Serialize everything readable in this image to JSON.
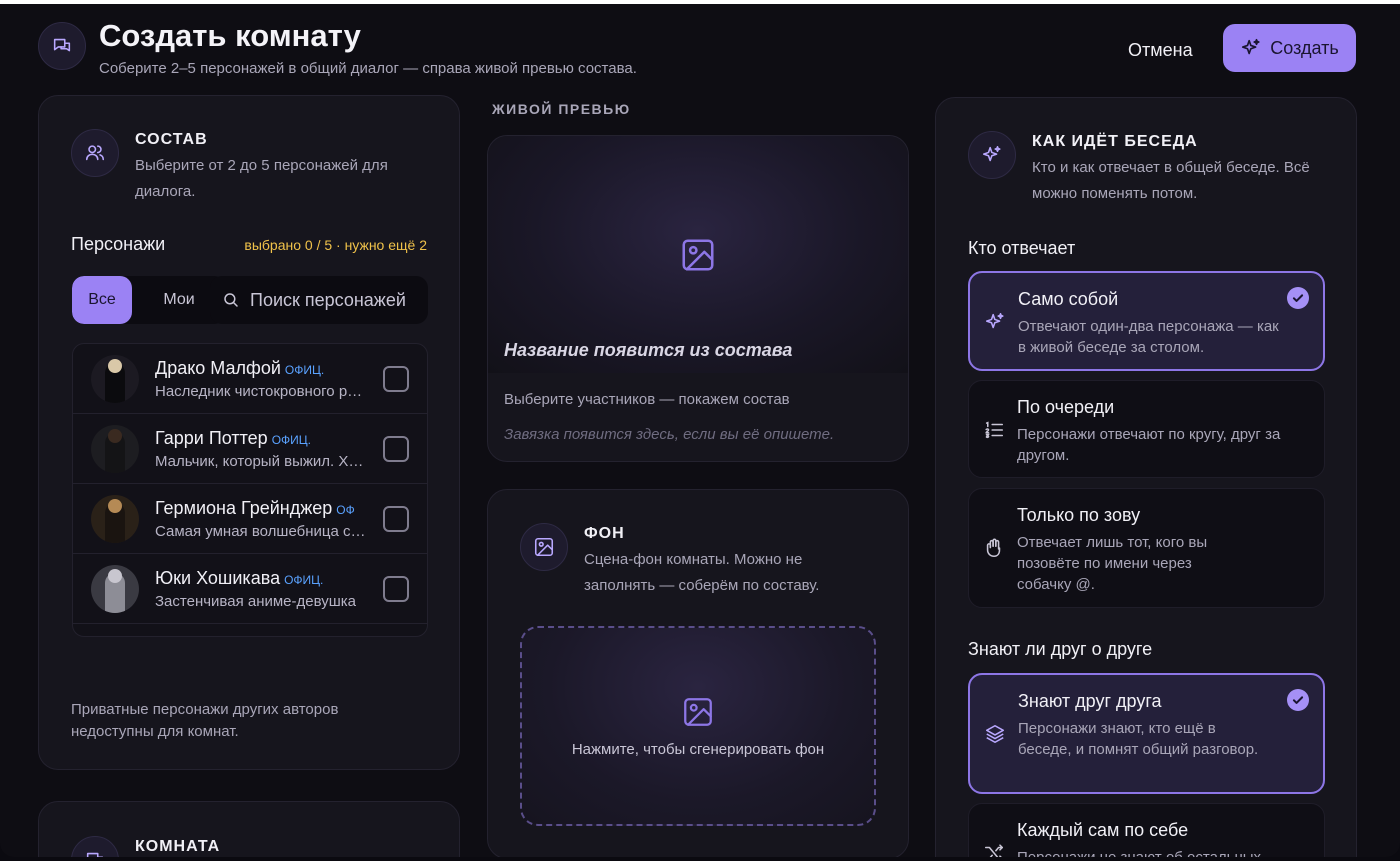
{
  "header": {
    "title": "Создать комнату",
    "subtitle": "Соберите 2–5 персонажей в общий диалог — справа живой превью состава.",
    "cancel_label": "Отмена",
    "create_label": "Создать"
  },
  "cast": {
    "title": "СОСТАВ",
    "description": "Выберите от 2 до 5 персонажей для диалога.",
    "characters_label": "Персонажи",
    "selected_status": "выбрано 0 / 5 · нужно ещё 2",
    "filter_all": "Все",
    "filter_mine": "Мои",
    "search_placeholder": "Поиск персонажей",
    "items": [
      {
        "name": "Драко Малфой",
        "badge": "ОФИЦ.",
        "desc": "Наследник чистокровного рода Малфоев"
      },
      {
        "name": "Гарри Поттер",
        "badge": "ОФИЦ.",
        "desc": "Мальчик, который выжил. Храбрый"
      },
      {
        "name": "Гермиона Грейнджер",
        "badge": "ОФ",
        "desc": "Самая умная волшебница своего поколения"
      },
      {
        "name": "Юки Хошикава",
        "badge": "ОФИЦ.",
        "desc": "Застенчивая аниме-девушка"
      }
    ],
    "note": "Приватные персонажи других авторов недоступны для комнат."
  },
  "room": {
    "title": "КОМНАТА"
  },
  "preview": {
    "label": "ЖИВОЙ ПРЕВЬЮ",
    "name_placeholder": "Название появится из состава",
    "members_hint": "Выберите участников — покажем состав",
    "plot_hint": "Завязка появится здесь, если вы её опишете."
  },
  "background": {
    "title": "ФОН",
    "description": "Сцена-фон комнаты. Можно не заполнять — соберём по составу.",
    "generate_label": "Нажмите, чтобы сгенерировать фон"
  },
  "conversation": {
    "title": "КАК ИДЁТ БЕСЕДА",
    "description": "Кто и как отвечает в общей беседе. Всё можно поменять потом.",
    "who_label": "Кто отвечает",
    "who_options": [
      {
        "title": "Само собой",
        "desc": "Отвечают один-два персонажа — как в живой беседе за столом.",
        "icon": "sparkle-icon",
        "selected": true
      },
      {
        "title": "По очереди",
        "desc": "Персонажи отвечают по кругу, друг за другом.",
        "icon": "numbered-list-icon",
        "selected": false
      },
      {
        "title": "Только по зову",
        "desc": "Отвечает лишь тот, кого вы позовёте по имени через собачку @.",
        "icon": "hand-icon",
        "selected": false
      }
    ],
    "know_label": "Знают ли друг о друге",
    "know_options": [
      {
        "title": "Знают друг друга",
        "desc": "Персонажи знают, кто ещё в беседе, и помнят общий разговор.",
        "icon": "layers-icon",
        "selected": true
      },
      {
        "title": "Каждый сам по себе",
        "desc": "Персонажи не знают об остальных",
        "icon": "shuffle-icon",
        "selected": false
      }
    ]
  },
  "colors": {
    "accent": "#9b82f4",
    "badge": "#5aa2ff",
    "warning": "#f0c24a",
    "panel": "#16151d"
  }
}
